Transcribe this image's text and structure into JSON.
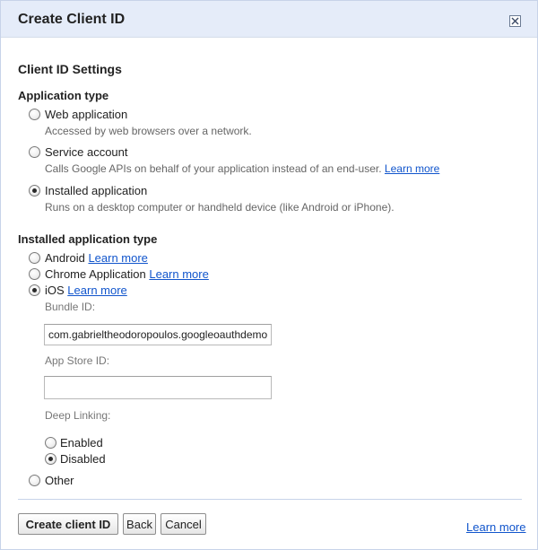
{
  "dialog": {
    "title": "Create Client ID",
    "close_label": "Close"
  },
  "settings": {
    "heading": "Client ID Settings",
    "app_type": {
      "heading": "Application type",
      "options": [
        {
          "label": "Web application",
          "desc": "Accessed by web browsers over a network.",
          "checked": false
        },
        {
          "label": "Service account",
          "desc": "Calls Google APIs on behalf of your application instead of an end-user.",
          "link": "Learn more",
          "checked": false
        },
        {
          "label": "Installed application",
          "desc": "Runs on a desktop computer or handheld device (like Android or iPhone).",
          "checked": true
        }
      ]
    },
    "installed_type": {
      "heading": "Installed application type",
      "options": [
        {
          "label": "Android",
          "link": "Learn more",
          "checked": false
        },
        {
          "label": "Chrome Application",
          "link": "Learn more",
          "checked": false
        },
        {
          "label": "iOS",
          "link": "Learn more",
          "checked": true
        },
        {
          "label": "Other",
          "checked": false
        }
      ]
    },
    "ios": {
      "bundle_label": "Bundle ID:",
      "bundle_value": "com.gabrieltheodoropoulos.googleoauthdemo",
      "appstore_label": "App Store ID:",
      "appstore_value": "",
      "deep_label": "Deep Linking:",
      "deep_options": [
        {
          "label": "Enabled",
          "checked": false
        },
        {
          "label": "Disabled",
          "checked": true
        }
      ]
    }
  },
  "footer": {
    "create_button": "Create client ID",
    "back_button": "Back",
    "cancel_button": "Cancel",
    "learn_more": "Learn more"
  },
  "colors": {
    "title_bar": "#e5ecf9",
    "link": "#1155cc"
  }
}
